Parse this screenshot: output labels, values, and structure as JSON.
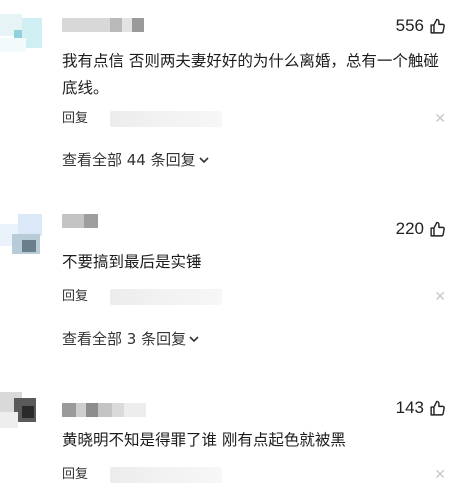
{
  "comments": [
    {
      "likes": "556",
      "text": "我有点信 否则两夫妻好好的为什么离婚，总有一个触碰底线。",
      "reply_label": "回复",
      "view_all": "查看全部 44 条回复"
    },
    {
      "likes": "220",
      "text": "不要搞到最后是实锤",
      "reply_label": "回复",
      "view_all": "查看全部 3 条回复"
    },
    {
      "likes": "143",
      "text": "黄晓明不知是得罪了谁 刚有点起色就被黑",
      "reply_label": "回复"
    }
  ],
  "icons": {
    "like": "thumbs-up-icon",
    "chevron": "chevron-down-icon",
    "close": "close-icon"
  }
}
